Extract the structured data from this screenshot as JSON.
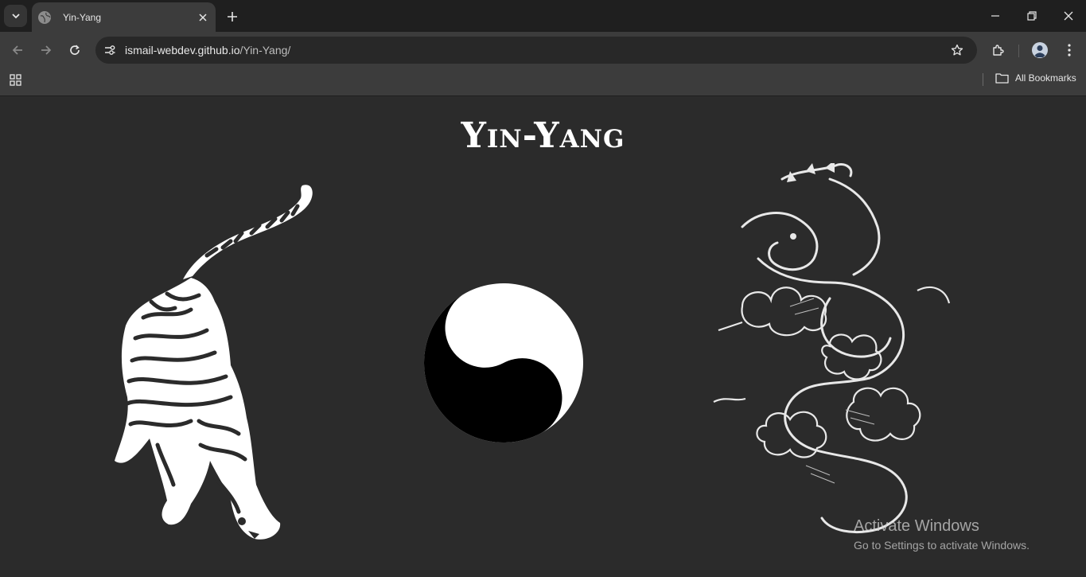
{
  "browser": {
    "tab_title": "Yin-Yang",
    "url_host": "ismail-webdev.github.io",
    "url_path": "/Yin-Yang/",
    "all_bookmarks_label": "All Bookmarks"
  },
  "page": {
    "title": "Yin-Yang"
  },
  "windows_watermark": {
    "line1": "Activate Windows",
    "line2": "Go to Settings to activate Windows."
  },
  "colors": {
    "page_background": "#2b2b2b",
    "yin": "#000000",
    "yang": "#ffffff"
  },
  "icons": [
    "tab-search-icon",
    "globe-icon",
    "close-icon",
    "plus-icon",
    "minimize-icon",
    "restore-icon",
    "back-icon",
    "forward-icon",
    "reload-icon",
    "site-info-icon",
    "star-icon",
    "extensions-icon",
    "profile-icon",
    "menu-icon",
    "apps-icon",
    "folder-icon"
  ]
}
